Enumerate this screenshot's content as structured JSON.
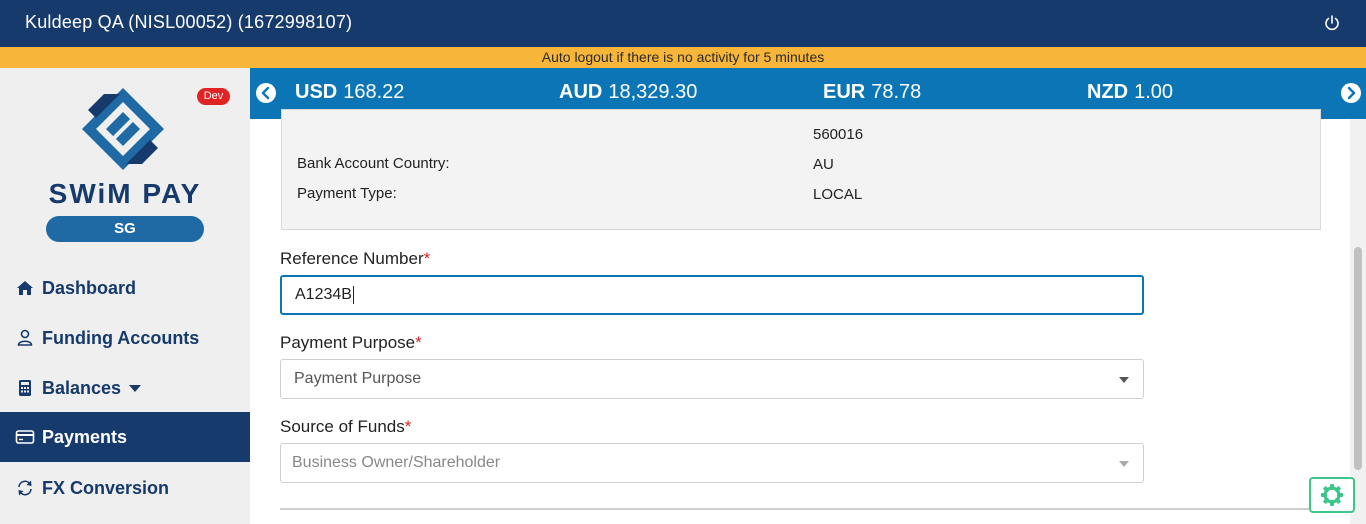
{
  "header": {
    "title": "Kuldeep QA (NISL00052) (1672998107)",
    "power_icon": "power-icon"
  },
  "notice": {
    "text": "Auto logout if there is no activity for 5 minutes",
    "color": "#f7b53a"
  },
  "sidebar": {
    "badge": "Dev",
    "brand": "SWiM PAY",
    "region": "SG",
    "items": [
      {
        "label": "Dashboard",
        "icon": "home-icon",
        "active": false
      },
      {
        "label": "Funding Accounts",
        "icon": "user-icon",
        "active": false
      },
      {
        "label": "Balances",
        "icon": "calculator-icon",
        "active": false,
        "has_caret": true
      },
      {
        "label": "Payments",
        "icon": "credit-card-icon",
        "active": true
      },
      {
        "label": "FX Conversion",
        "icon": "refresh-icon",
        "active": false
      }
    ]
  },
  "ticker": {
    "rates": [
      {
        "code": "USD",
        "value": "168.22"
      },
      {
        "code": "AUD",
        "value": "18,329.30"
      },
      {
        "code": "EUR",
        "value": "78.78"
      },
      {
        "code": "NZD",
        "value": "1.00"
      }
    ]
  },
  "details": {
    "partial_value_line": "560016",
    "rows": [
      {
        "label": "Bank Account Country:",
        "value": "AU"
      },
      {
        "label": "Payment Type:",
        "value": "LOCAL"
      }
    ]
  },
  "form": {
    "reference": {
      "label": "Reference Number",
      "required": "*",
      "value": "A1234B"
    },
    "purpose": {
      "label": "Payment Purpose",
      "required": "*",
      "placeholder": "Payment Purpose"
    },
    "source": {
      "label": "Source of Funds",
      "required": "*",
      "value": "Business Owner/Shareholder"
    }
  },
  "colors": {
    "navy": "#163a6b",
    "ticker_blue": "#0c75b6",
    "required_red": "#d42323",
    "settings_green": "#3cc68a"
  }
}
